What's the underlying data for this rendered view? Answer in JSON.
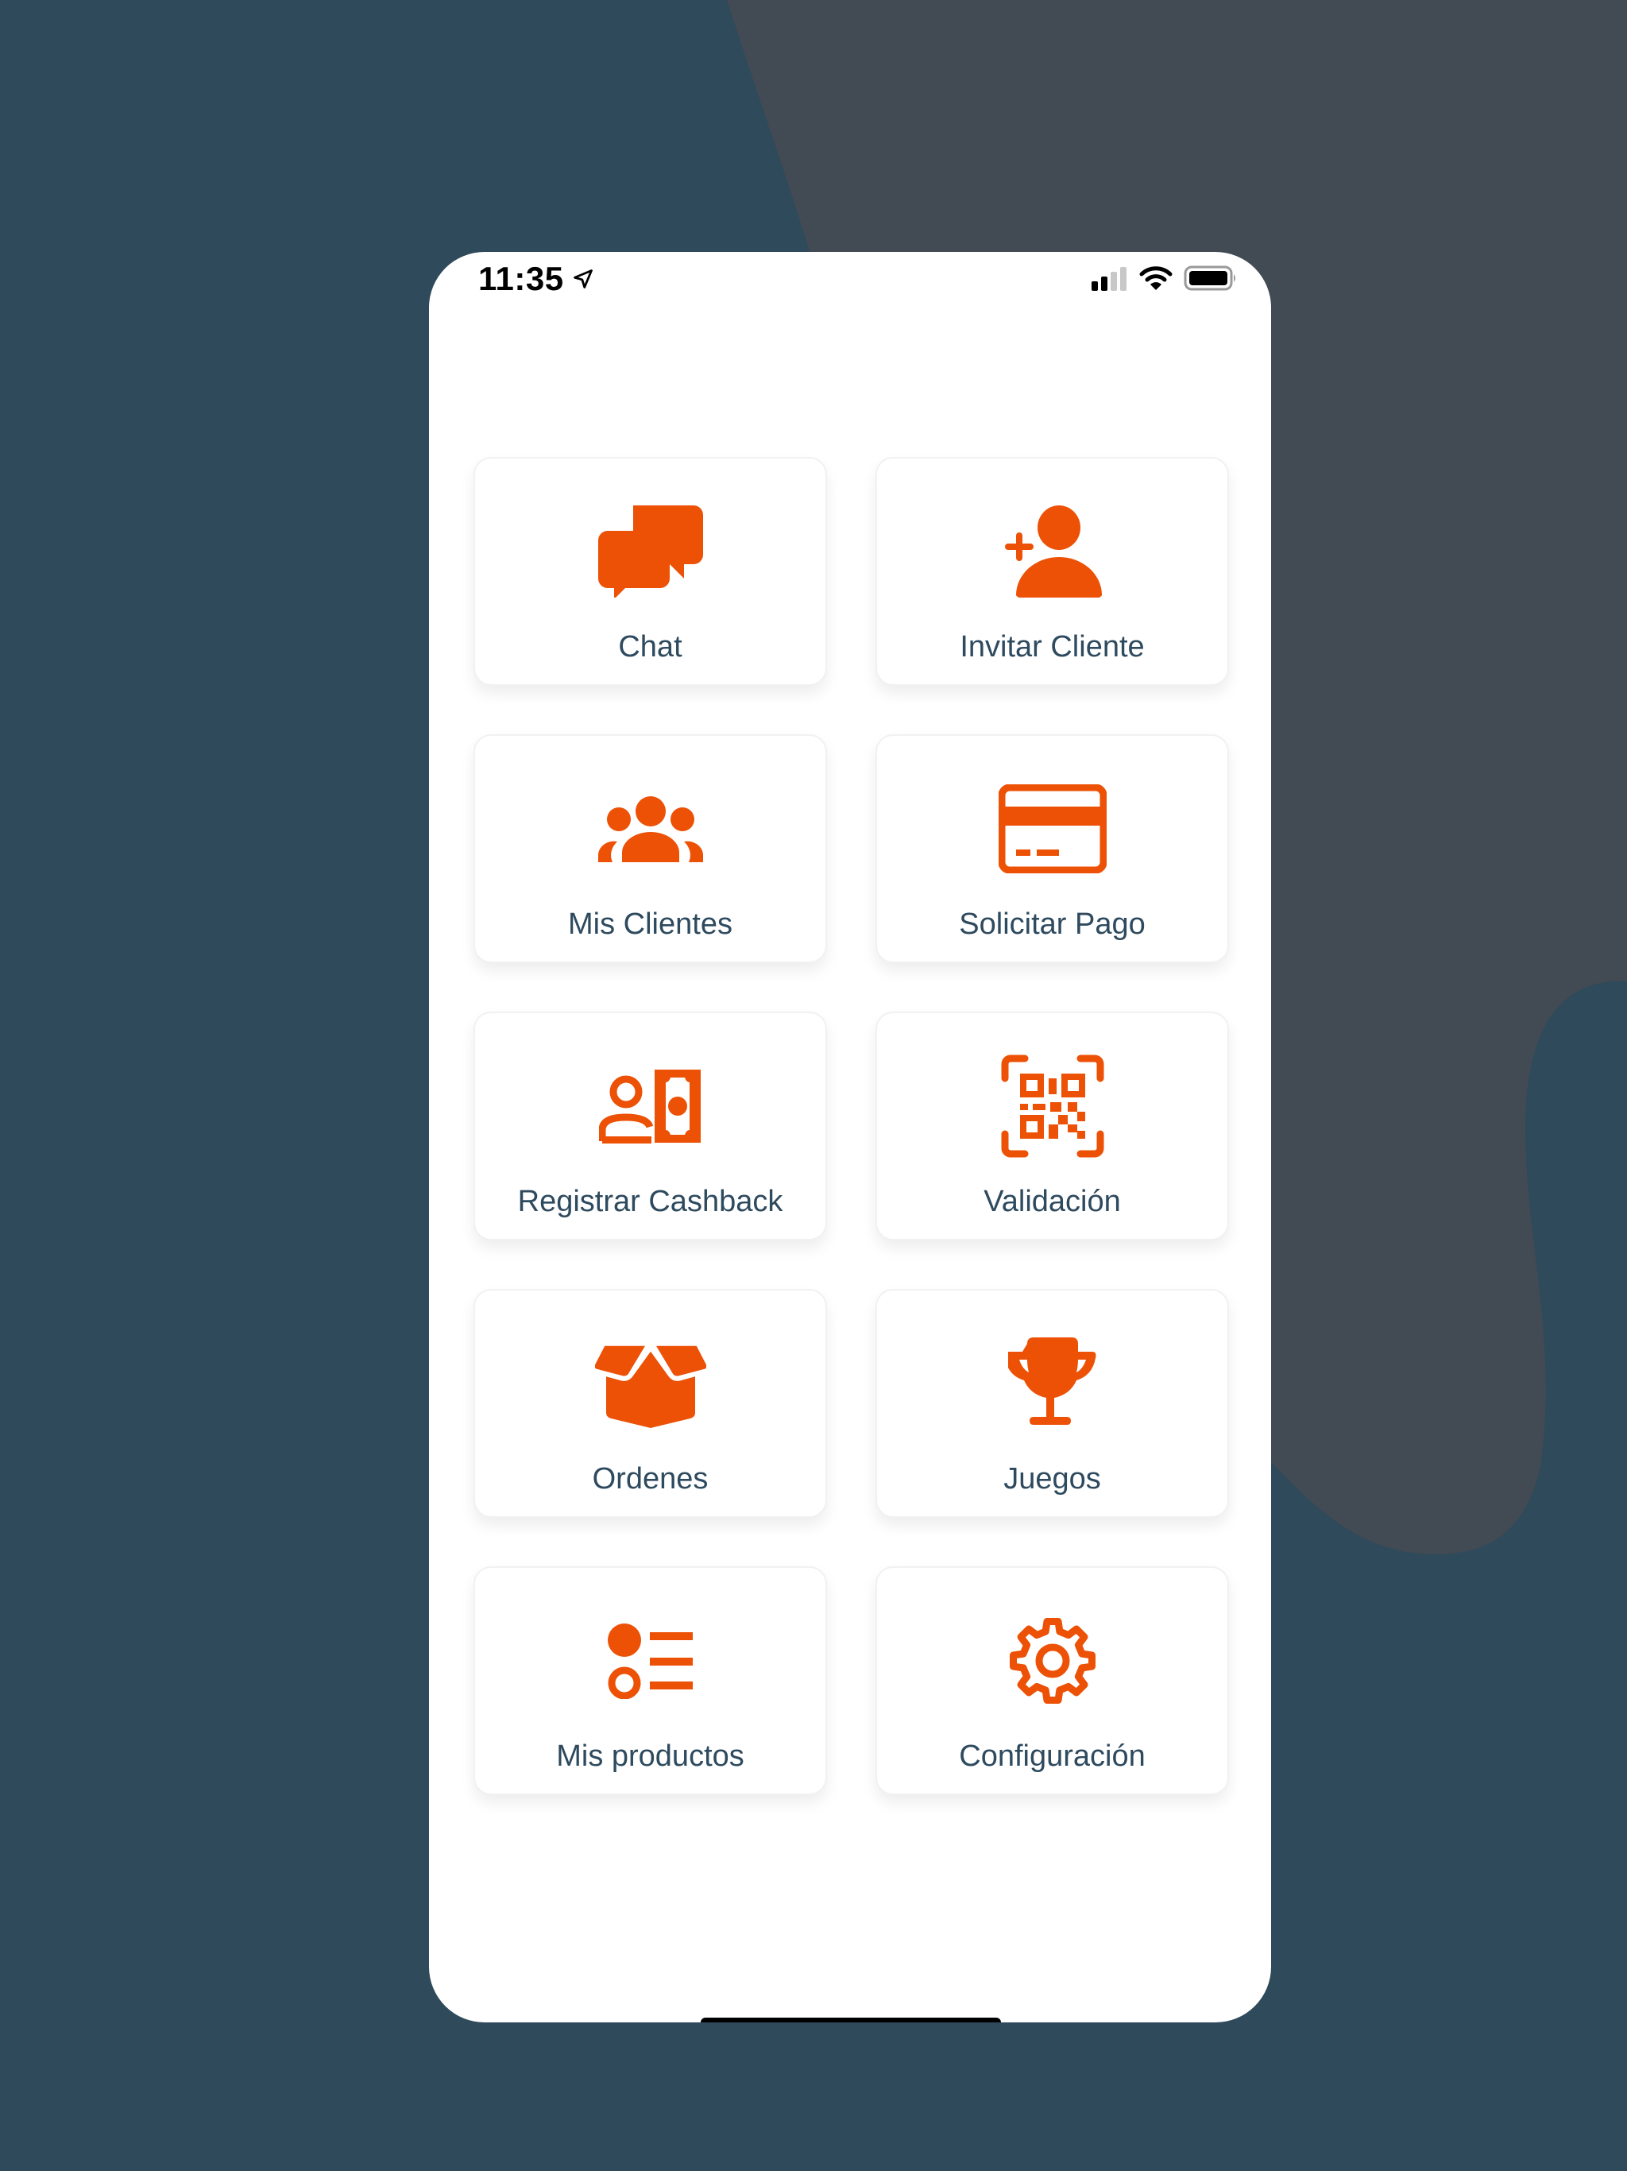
{
  "status_bar": {
    "time": "11:35",
    "location_icon": "location-arrow-icon",
    "signal_bars_filled": 2,
    "signal_bars_total": 4,
    "wifi_icon": "wifi-icon",
    "battery_icon": "battery-icon"
  },
  "colors": {
    "accent": "#EC5106",
    "label_text": "#2E4A5E",
    "background": "#2F4A5B",
    "background_blob": "#424A53"
  },
  "menu": {
    "items": [
      {
        "label": "Chat",
        "icon": "chat-bubbles-icon"
      },
      {
        "label": "Invitar Cliente",
        "icon": "user-plus-icon"
      },
      {
        "label": "Mis Clientes",
        "icon": "users-group-icon"
      },
      {
        "label": "Solicitar Pago",
        "icon": "credit-card-icon"
      },
      {
        "label": "Registrar Cashback",
        "icon": "user-money-icon"
      },
      {
        "label": "Validación",
        "icon": "qr-scan-icon"
      },
      {
        "label": "Ordenes",
        "icon": "open-box-icon"
      },
      {
        "label": "Juegos",
        "icon": "trophy-icon"
      },
      {
        "label": "Mis productos",
        "icon": "list-icon"
      },
      {
        "label": "Configuración",
        "icon": "gear-icon"
      }
    ]
  }
}
